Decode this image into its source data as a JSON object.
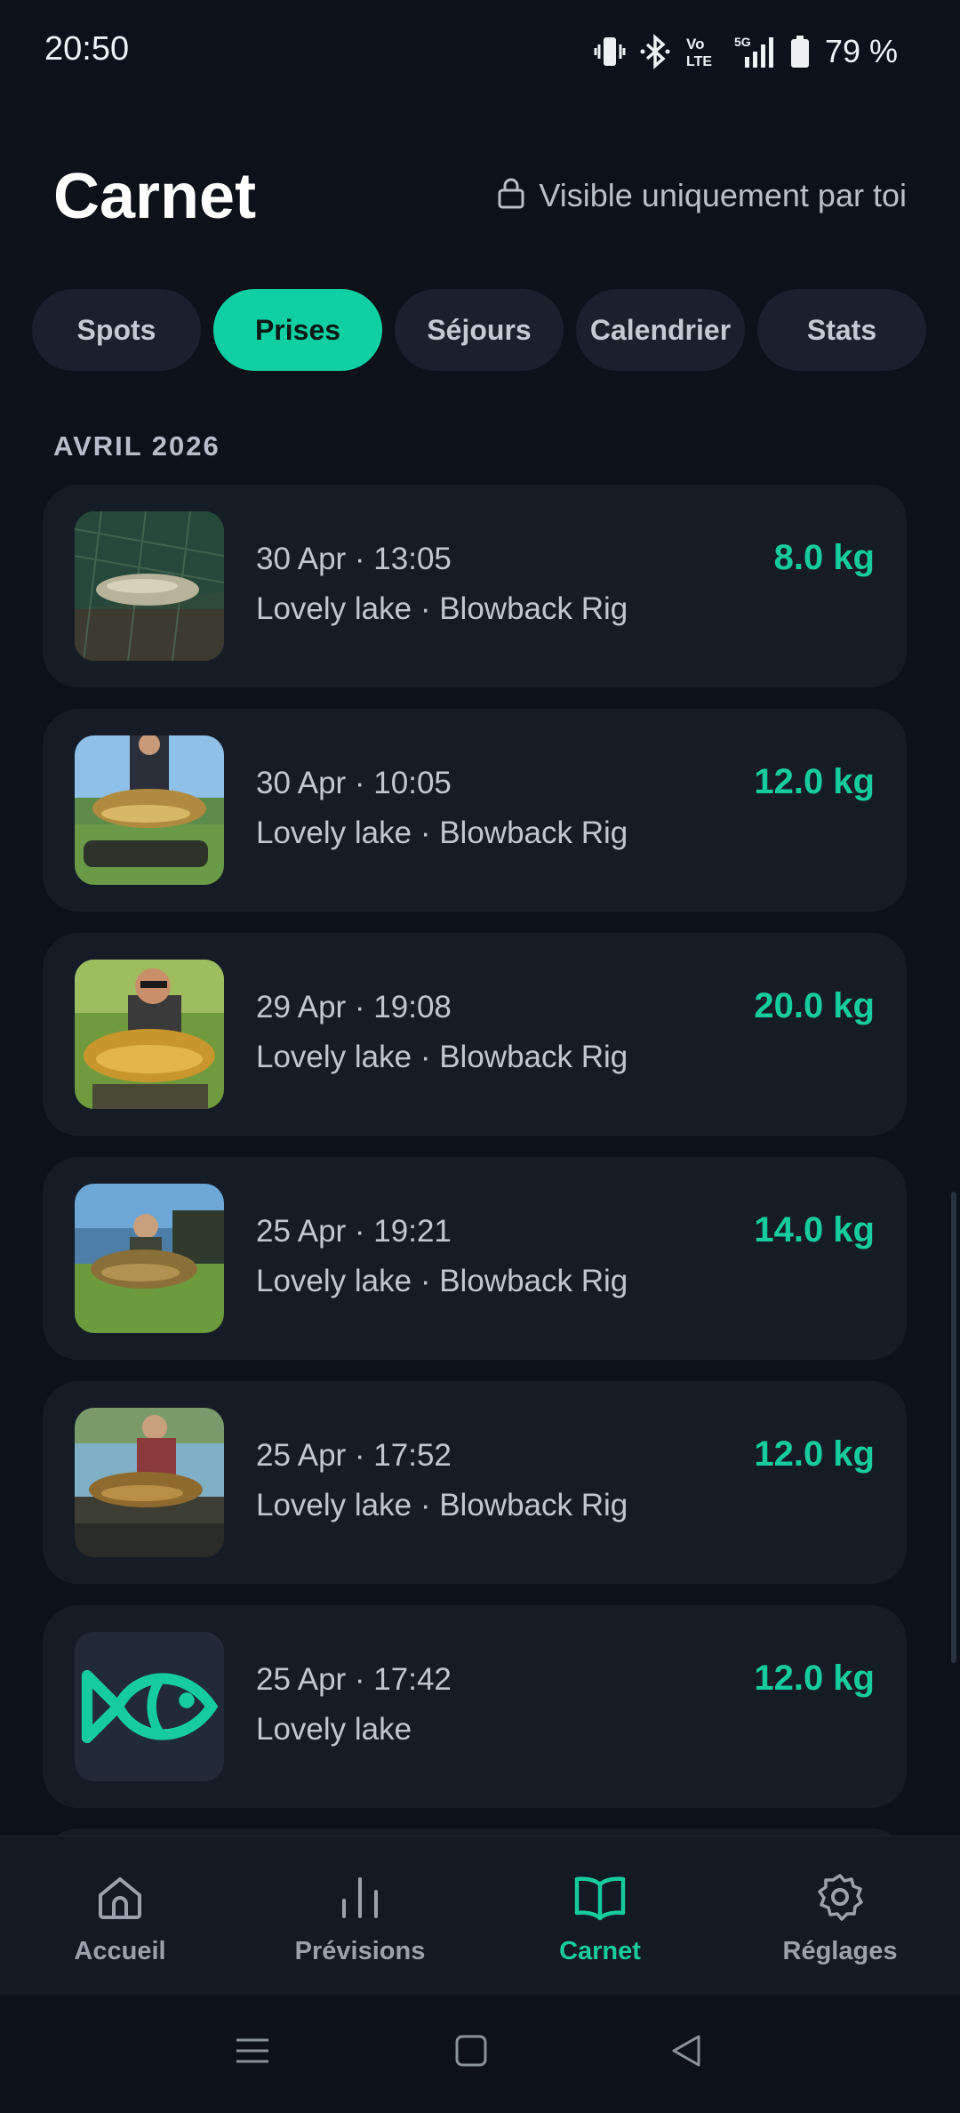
{
  "status_bar": {
    "time": "20:50",
    "battery_text": "79 %",
    "icons": [
      "vibrate-icon",
      "bluetooth-icon",
      "volte-icon",
      "5g-signal-icon",
      "battery-icon"
    ]
  },
  "header": {
    "title": "Carnet",
    "privacy_text": "Visible uniquement par toi",
    "privacy_icon": "lock-icon"
  },
  "tabs": [
    {
      "label": "Spots",
      "active": false
    },
    {
      "label": "Prises",
      "active": true
    },
    {
      "label": "Séjours",
      "active": false
    },
    {
      "label": "Calendrier",
      "active": false
    },
    {
      "label": "Stats",
      "active": false
    }
  ],
  "section": {
    "label": "AVRIL 2026"
  },
  "catches": [
    {
      "date": "30 Apr · 13:05",
      "meta": "Lovely lake  · Blowback Rig",
      "weight": "8.0 kg"
    },
    {
      "date": "30 Apr · 10:05",
      "meta": "Lovely lake  · Blowback Rig",
      "weight": "12.0 kg"
    },
    {
      "date": "29 Apr · 19:08",
      "meta": "Lovely lake  · Blowback Rig",
      "weight": "20.0 kg"
    },
    {
      "date": "25 Apr · 19:21",
      "meta": "Lovely lake  · Blowback Rig",
      "weight": "14.0 kg"
    },
    {
      "date": "25 Apr · 17:52",
      "meta": "Lovely lake  · Blowback Rig",
      "weight": "12.0 kg"
    },
    {
      "date": "25 Apr · 17:42",
      "meta": "Lovely lake",
      "weight": "12.0 kg"
    }
  ],
  "bottom_nav": [
    {
      "label": "Accueil",
      "icon": "home-icon",
      "active": false
    },
    {
      "label": "Prévisions",
      "icon": "bar-chart-icon",
      "active": false
    },
    {
      "label": "Carnet",
      "icon": "book-icon",
      "active": true
    },
    {
      "label": "Réglages",
      "icon": "gear-icon",
      "active": false
    }
  ],
  "colors": {
    "accent": "#16cc9f",
    "background": "#0c111a",
    "card": "#161c26"
  }
}
